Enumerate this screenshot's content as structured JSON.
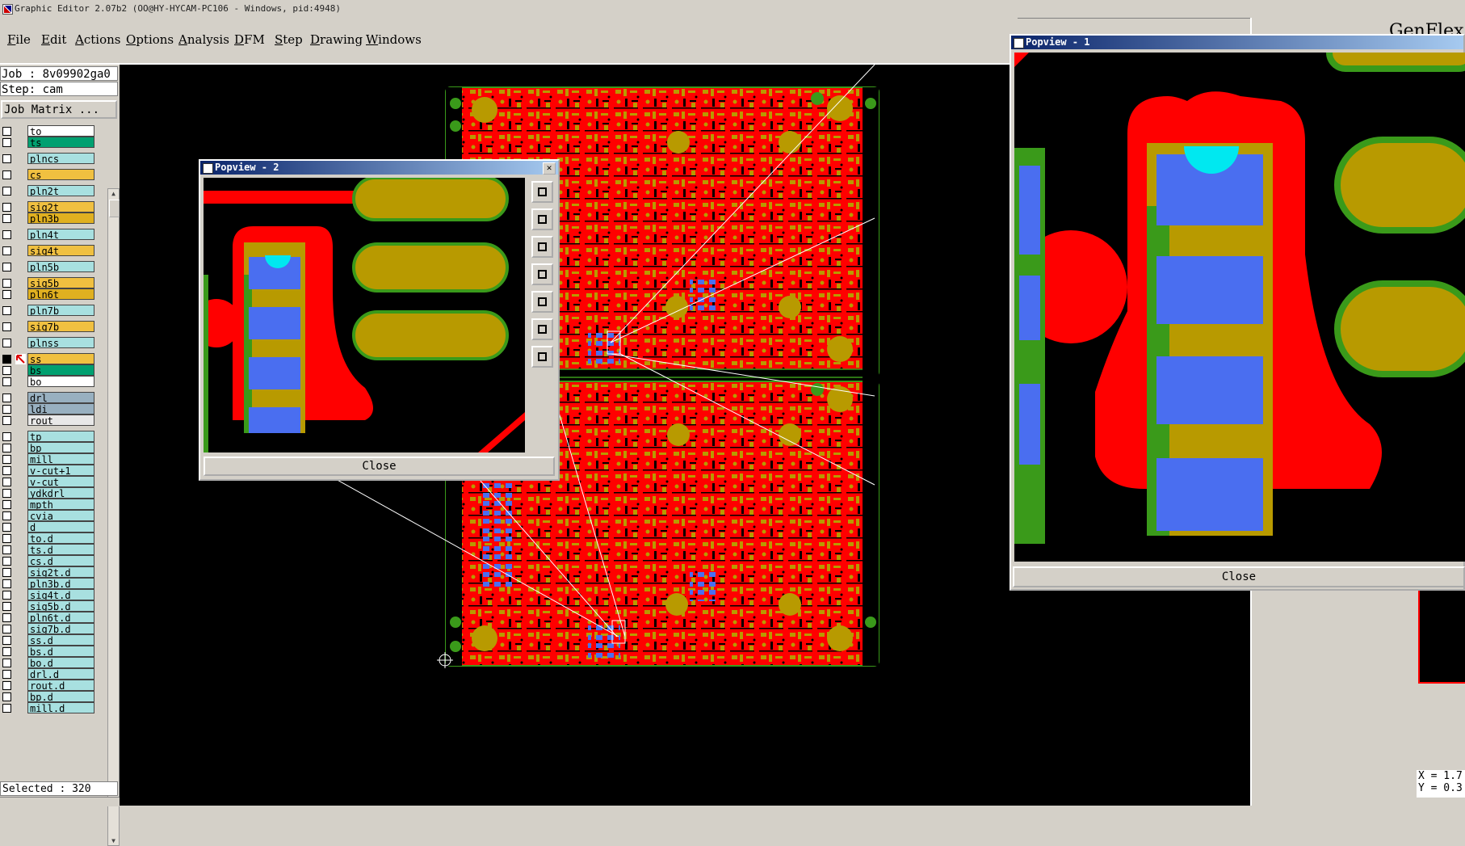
{
  "window": {
    "title": "Graphic Editor 2.07b2 (OO@HY-HYCAM-PC106 - Windows, pid:4948)"
  },
  "menu": [
    "File",
    "Edit",
    "Actions",
    "Options",
    "Analysis",
    "DFM",
    "Step",
    "Drawing",
    "Windows"
  ],
  "job": {
    "job_label": "Job : 8v09902ga0",
    "step_label": "Step: cam",
    "matrix_button": "Job Matrix ..."
  },
  "layers": [
    {
      "name": "to",
      "color": "#ffffff",
      "group": 0
    },
    {
      "name": "ts",
      "color": "#00a070",
      "group": 0
    },
    {
      "name": "plncs",
      "color": "#a8e0e0",
      "group": 1
    },
    {
      "name": "cs",
      "color": "#f0c040",
      "group": 2
    },
    {
      "name": "pln2t",
      "color": "#a8e0e0",
      "group": 3
    },
    {
      "name": "sig2t",
      "color": "#f0c040",
      "group": 4
    },
    {
      "name": "pln3b",
      "color": "#e0b020",
      "group": 4
    },
    {
      "name": "pln4t",
      "color": "#a8e0e0",
      "group": 5
    },
    {
      "name": "sig4t",
      "color": "#f0c040",
      "group": 6
    },
    {
      "name": "pln5b",
      "color": "#a8e0e0",
      "group": 7
    },
    {
      "name": "sig5b",
      "color": "#f0c040",
      "group": 8
    },
    {
      "name": "pln6t",
      "color": "#e0b020",
      "group": 8
    },
    {
      "name": "pln7b",
      "color": "#a8e0e0",
      "group": 9
    },
    {
      "name": "sig7b",
      "color": "#f0c040",
      "group": 10
    },
    {
      "name": "plnss",
      "color": "#a8e0e0",
      "group": 11
    },
    {
      "name": "ss",
      "color": "#f0c040",
      "group": 12,
      "active": true
    },
    {
      "name": "bs",
      "color": "#00a070",
      "group": 12
    },
    {
      "name": "bo",
      "color": "#ffffff",
      "group": 12
    },
    {
      "name": "drl",
      "color": "#98b0c0",
      "group": 13
    },
    {
      "name": "ldi",
      "color": "#98b0c0",
      "group": 13
    },
    {
      "name": "rout",
      "color": "#e8e8e8",
      "group": 13
    },
    {
      "name": "tp",
      "color": "#a8e0e0",
      "group": 14
    },
    {
      "name": "bp",
      "color": "#a8e0e0",
      "group": 14
    },
    {
      "name": "mill",
      "color": "#a8e0e0",
      "group": 14
    },
    {
      "name": "v-cut+1",
      "color": "#a8e0e0",
      "group": 14
    },
    {
      "name": "v-cut",
      "color": "#a8e0e0",
      "group": 14
    },
    {
      "name": "ydkdrl",
      "color": "#a8e0e0",
      "group": 14
    },
    {
      "name": "mpth",
      "color": "#a8e0e0",
      "group": 14
    },
    {
      "name": "cvia",
      "color": "#a8e0e0",
      "group": 14
    },
    {
      "name": "d",
      "color": "#a8e0e0",
      "group": 14
    },
    {
      "name": "to.d",
      "color": "#a8e0e0",
      "group": 14
    },
    {
      "name": "ts.d",
      "color": "#a8e0e0",
      "group": 14
    },
    {
      "name": "cs.d",
      "color": "#a8e0e0",
      "group": 14
    },
    {
      "name": "sig2t.d",
      "color": "#a8e0e0",
      "group": 14
    },
    {
      "name": "pln3b.d",
      "color": "#a8e0e0",
      "group": 14
    },
    {
      "name": "sig4t.d",
      "color": "#a8e0e0",
      "group": 14
    },
    {
      "name": "sig5b.d",
      "color": "#a8e0e0",
      "group": 14
    },
    {
      "name": "pln6t.d",
      "color": "#a8e0e0",
      "group": 14
    },
    {
      "name": "sig7b.d",
      "color": "#a8e0e0",
      "group": 14
    },
    {
      "name": "ss.d",
      "color": "#a8e0e0",
      "group": 14
    },
    {
      "name": "bs.d",
      "color": "#a8e0e0",
      "group": 14
    },
    {
      "name": "bo.d",
      "color": "#a8e0e0",
      "group": 14
    },
    {
      "name": "drl.d",
      "color": "#a8e0e0",
      "group": 14
    },
    {
      "name": "rout.d",
      "color": "#a8e0e0",
      "group": 14
    },
    {
      "name": "bp.d",
      "color": "#a8e0e0",
      "group": 14
    },
    {
      "name": "mill.d",
      "color": "#a8e0e0",
      "group": 14
    }
  ],
  "status": {
    "selected": "Selected : 320"
  },
  "popview2": {
    "title": "Popview - 2",
    "close_label": "Close"
  },
  "popview1": {
    "title": "Popview - 1",
    "close_label": "Close"
  },
  "right_window": {
    "title_partial": "GenFlex",
    "coord_x": "X = 1.7",
    "coord_y": "Y = 0.3"
  },
  "colors": {
    "copper": "#ff0000",
    "pad": "#b89a00",
    "mask": "#3a9a1a",
    "drill": "#4a6ef0",
    "hole": "#00e8f0",
    "background": "#000000"
  }
}
